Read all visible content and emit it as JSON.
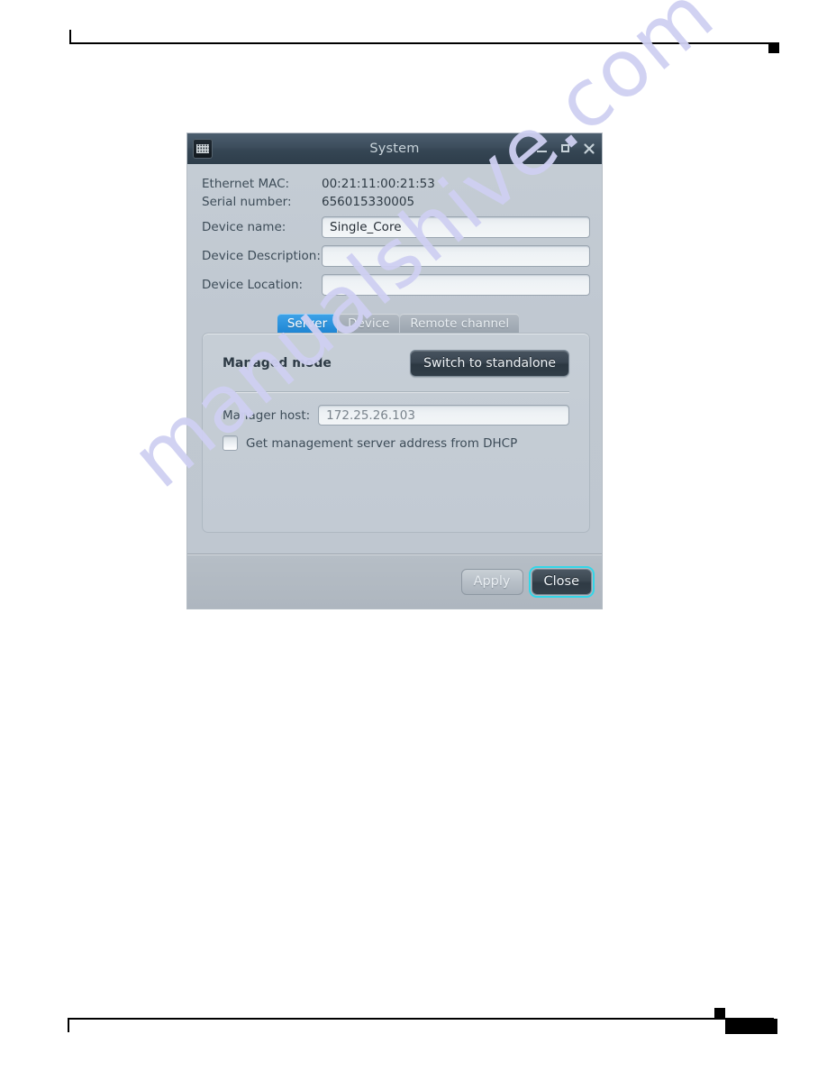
{
  "page": {
    "header_marker": "rule-with-tick-and-square",
    "footer_marker": "rule-with-tick-and-redacted-page-number"
  },
  "watermark": {
    "text": "manualshive.com",
    "color": "#cfd0f2"
  },
  "window": {
    "title": "System",
    "icon": "keypad-icon",
    "controls": {
      "minimize": "Minimize",
      "maximize": "Maximize",
      "close": "Close"
    }
  },
  "info": [
    {
      "label": "Ethernet MAC:",
      "value": "00:21:11:00:21:53"
    },
    {
      "label": "Serial number:",
      "value": "656015330005"
    }
  ],
  "fields": [
    {
      "label": "Device name:",
      "value": "Single_Core",
      "placeholder": ""
    },
    {
      "label": "Device Description:",
      "value": "",
      "placeholder": ""
    },
    {
      "label": "Device Location:",
      "value": "",
      "placeholder": ""
    }
  ],
  "tabs": [
    {
      "label": "Server",
      "active": true
    },
    {
      "label": "Device",
      "active": false
    },
    {
      "label": "Remote channel",
      "active": false
    }
  ],
  "server_panel": {
    "mode_label": "Managed mode",
    "switch_button": "Switch to standalone",
    "host_label": "Manager host:",
    "host_value": "172.25.26.103",
    "dhcp_checkbox_label": "Get management server address from DHCP",
    "dhcp_checked": false
  },
  "footer": {
    "apply_label": "Apply",
    "close_label": "Close"
  },
  "colors": {
    "accent_tab": "#1f86d4",
    "focus_ring": "#33d6e8",
    "titlebar": "#354654",
    "dialog_body": "#c0c8d1"
  }
}
